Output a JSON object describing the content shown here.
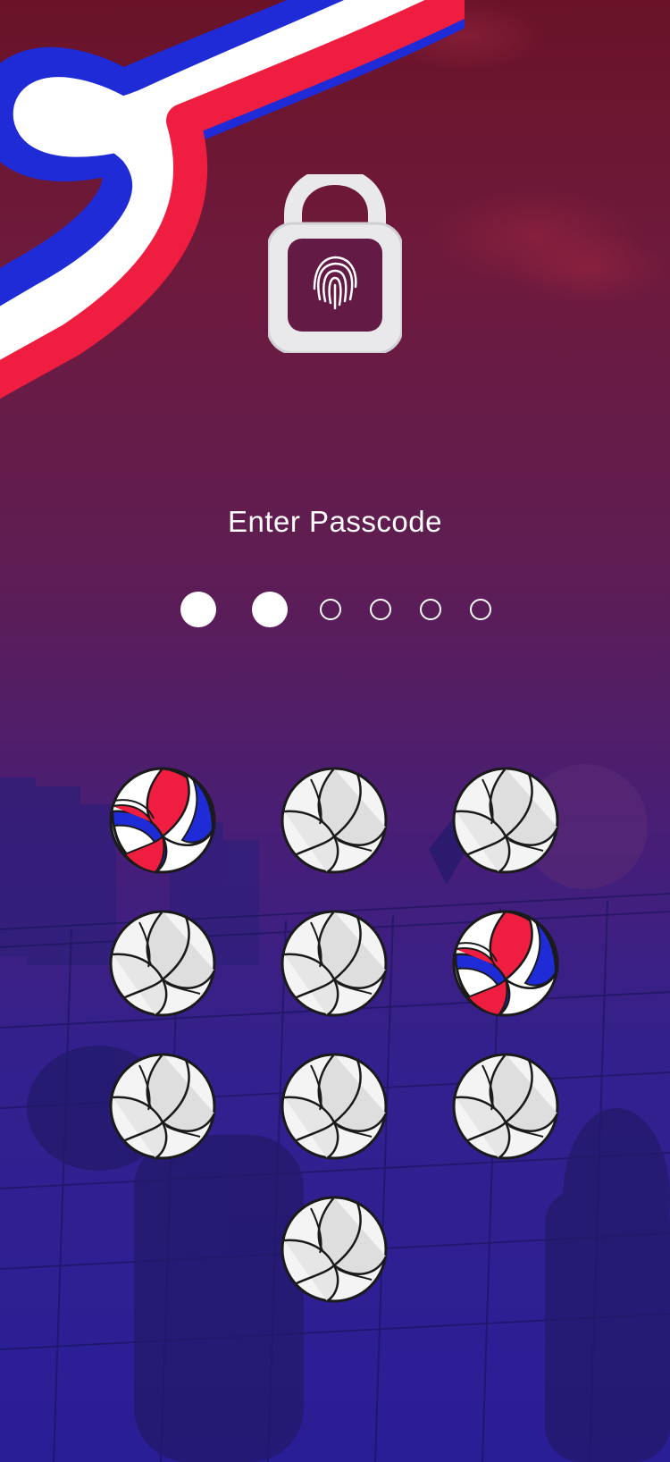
{
  "screen": {
    "title": "Enter Passcode",
    "passcode_length": 6,
    "digits_entered": 2
  },
  "icons": {
    "lock": "unlocked-padlock-fingerprint-icon",
    "key": "volleyball-icon"
  },
  "colors": {
    "flag_blue": "#1e2bd6",
    "flag_white": "#ffffff",
    "flag_red": "#ef1d3f",
    "dot": "#ffffff"
  },
  "keypad": {
    "keys": [
      {
        "style": "flag"
      },
      {
        "style": "plain"
      },
      {
        "style": "plain"
      },
      {
        "style": "plain"
      },
      {
        "style": "plain"
      },
      {
        "style": "flag"
      },
      {
        "style": "plain"
      },
      {
        "style": "plain"
      },
      {
        "style": "plain"
      },
      {
        "style": "plain"
      }
    ]
  }
}
